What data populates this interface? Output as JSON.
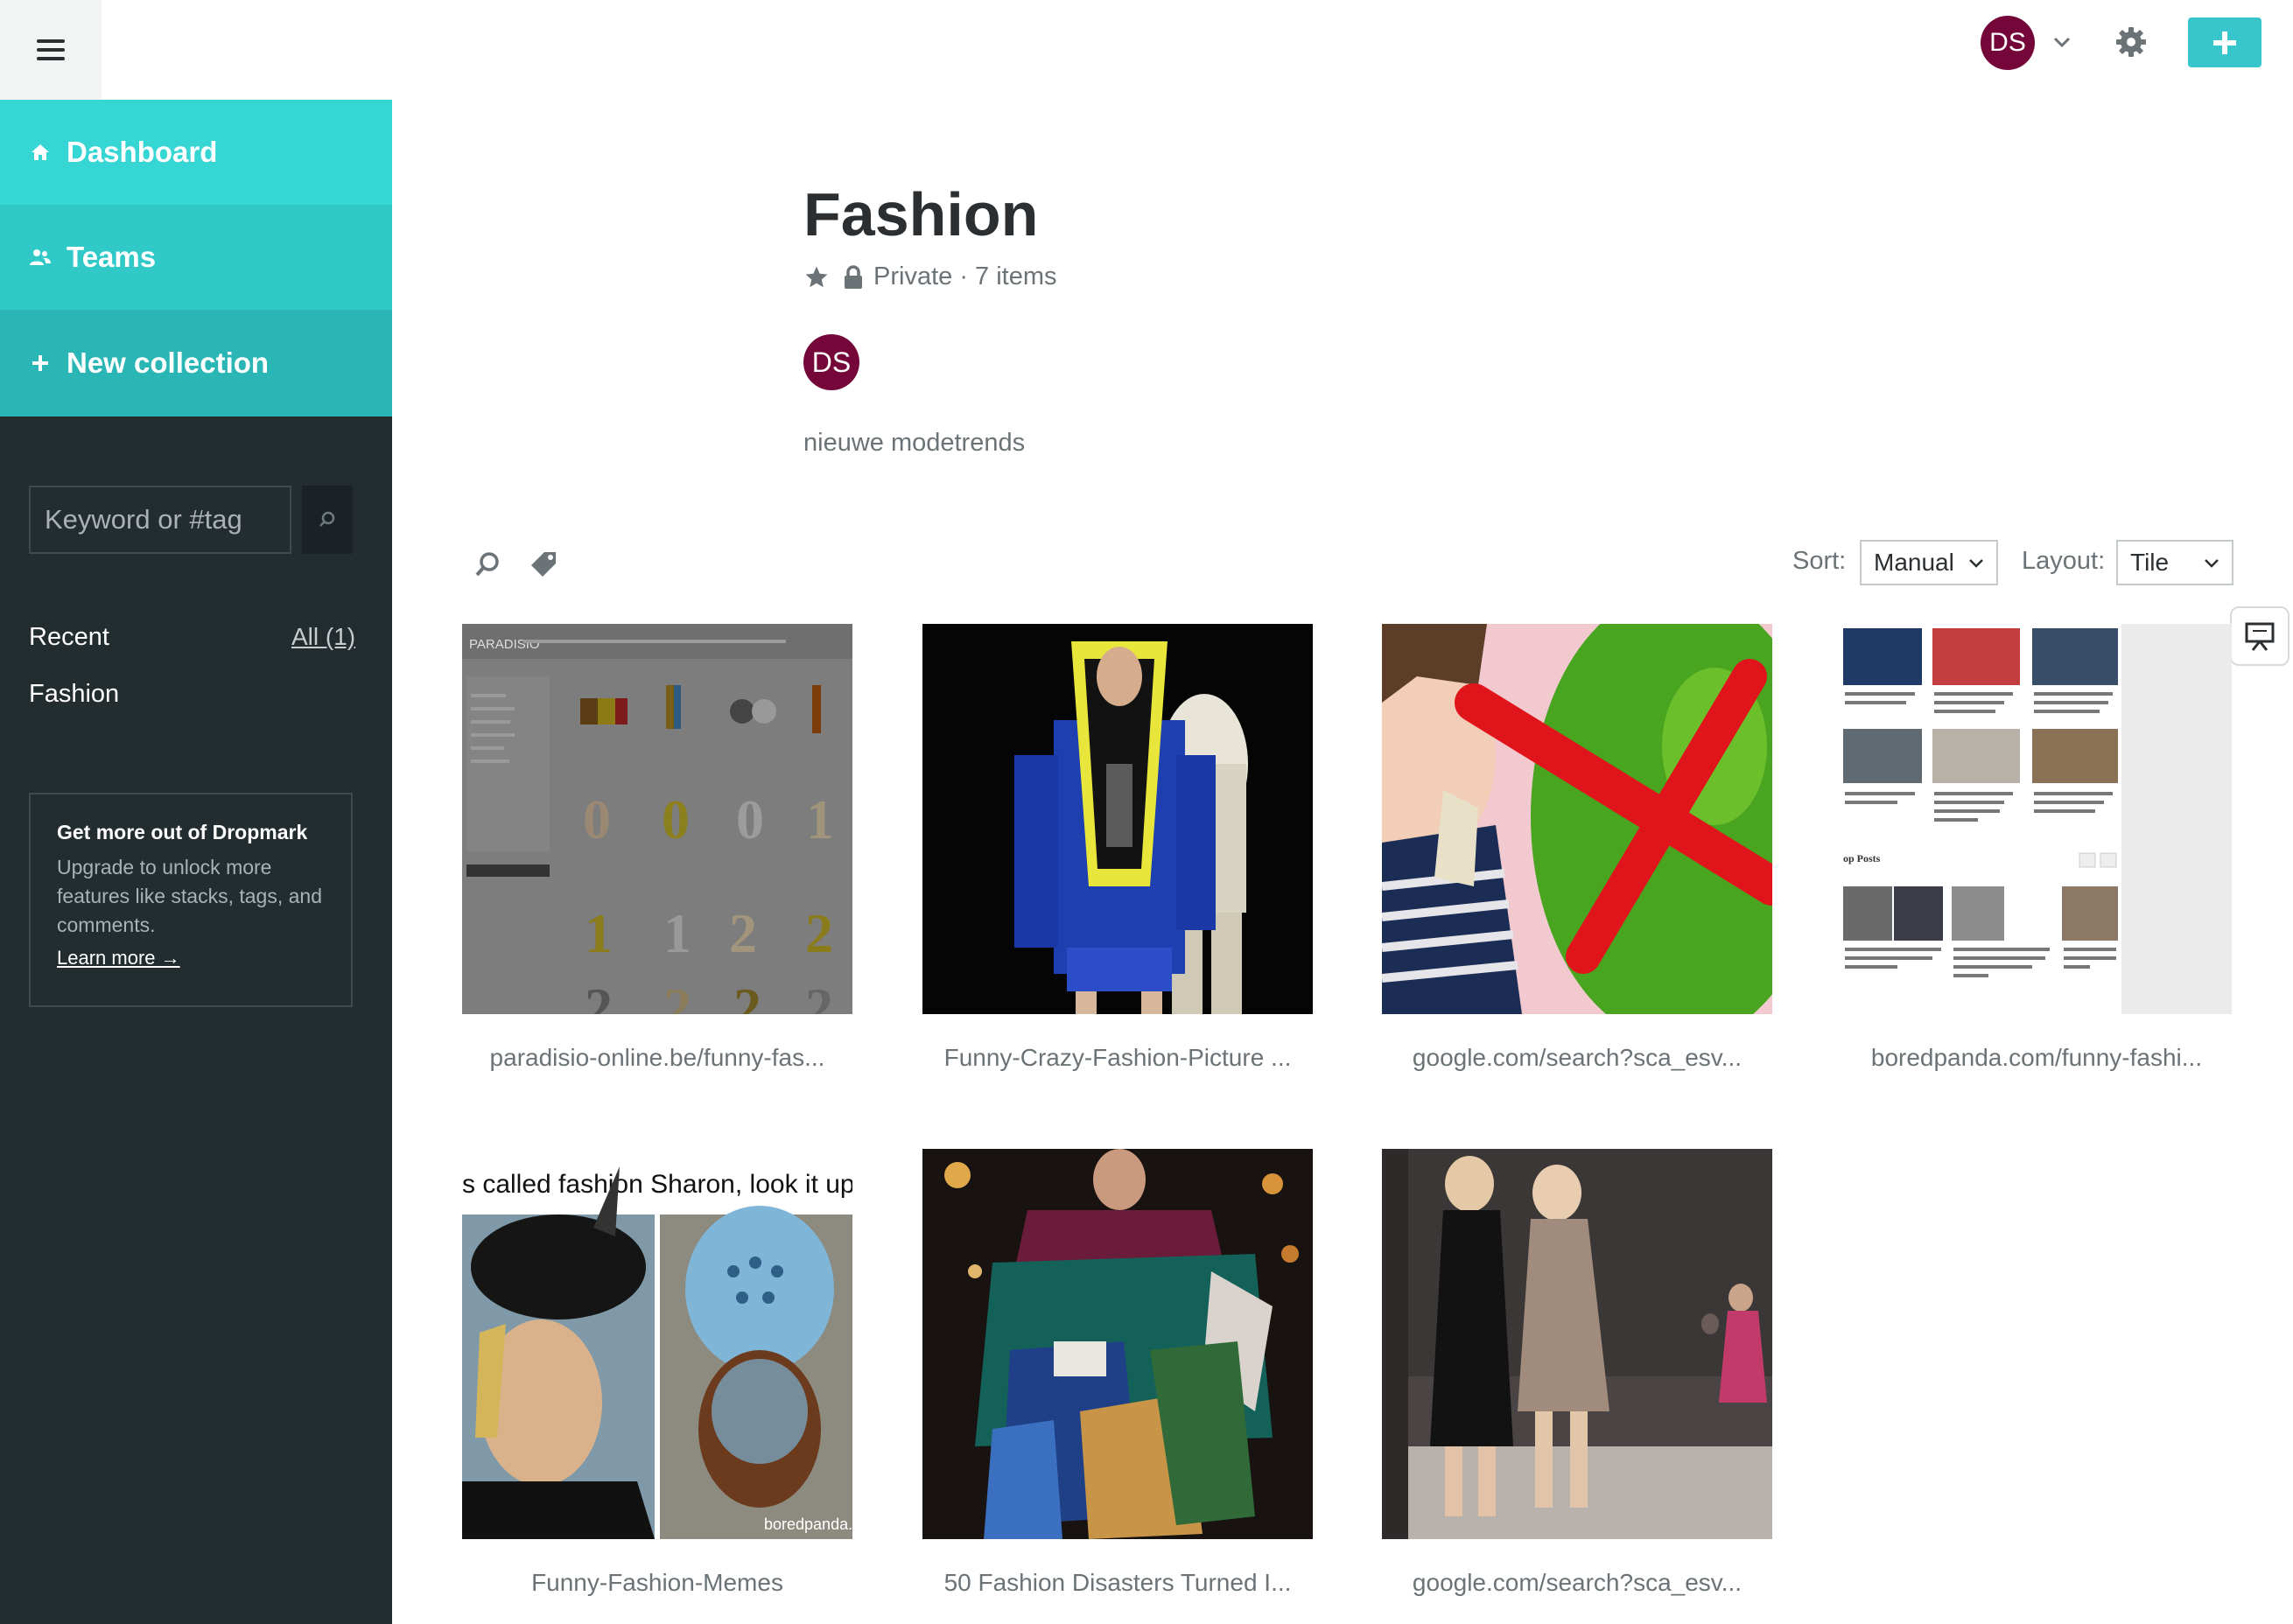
{
  "sidebar": {
    "nav": [
      {
        "label": "Dashboard",
        "icon": "home-icon"
      },
      {
        "label": "Teams",
        "icon": "people-icon"
      },
      {
        "label": "New collection",
        "icon": "plus-icon"
      }
    ],
    "search_placeholder": "Keyword or #tag",
    "recent_label": "Recent",
    "recent_all": "All (1)",
    "recent_items": [
      "Fashion"
    ],
    "promo": {
      "title": "Get more out of Dropmark",
      "text": "Upgrade to unlock more features like stacks, tags, and comments.",
      "link": "Learn more →"
    }
  },
  "header": {
    "avatar_initials": "DS",
    "accent": "#36c6cb",
    "avatar_color": "#75063a"
  },
  "collection": {
    "title": "Fashion",
    "meta": "Private · 7 items",
    "owner_initials": "DS",
    "description": "nieuwe modetrends"
  },
  "toolbar": {
    "sort_label": "Sort:",
    "sort_value": "Manual",
    "layout_label": "Layout:",
    "layout_value": "Tile"
  },
  "items": [
    {
      "caption": "paradisio-online.be/funny-fas..."
    },
    {
      "caption": "Funny-Crazy-Fashion-Picture ..."
    },
    {
      "caption": "google.com/search?sca_esv..."
    },
    {
      "caption": "boredpanda.com/funny-fashi..."
    },
    {
      "caption": "Funny-Fashion-Memes"
    },
    {
      "caption": "50 Fashion Disasters Turned I..."
    },
    {
      "caption": "google.com/search?sca_esv..."
    }
  ],
  "thumb_text": {
    "paradisio_logo": "PARADISIO",
    "meme_caption": "s called fashion Sharon, look it up",
    "meme_watermark": "boredpanda.",
    "boredpanda_section": "op Posts"
  }
}
